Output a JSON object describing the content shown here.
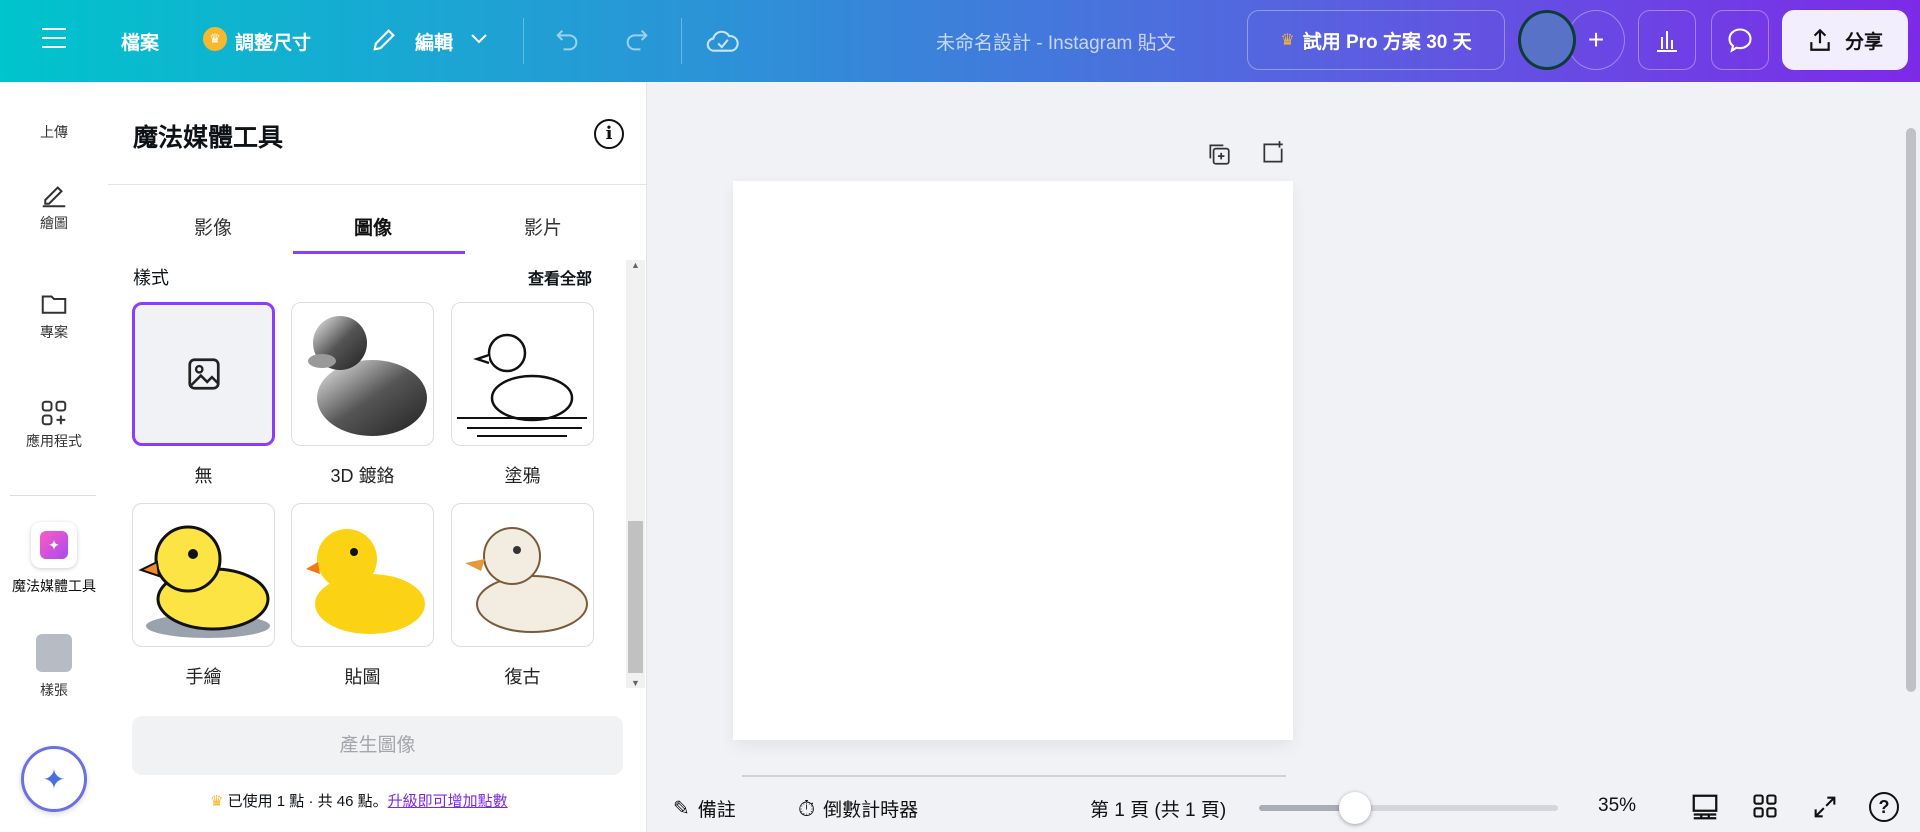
{
  "topbar": {
    "file": "檔案",
    "resize": "調整尺寸",
    "edit": "編輯",
    "title": "未命名設計 - Instagram 貼文",
    "pro": "試用 Pro 方案 30 天",
    "share": "分享"
  },
  "rail": {
    "upload": "上傳",
    "draw": "繪圖",
    "projects": "專案",
    "apps": "應用程式",
    "magic_media": "魔法媒體工具",
    "mockups": "樣張"
  },
  "panel": {
    "title": "魔法媒體工具",
    "tabs": [
      "影像",
      "圖像",
      "影片"
    ],
    "active_tab": "圖像",
    "styles_label": "樣式",
    "see_all": "查看全部",
    "styles": [
      "無",
      "3D 鍍鉻",
      "塗鴉",
      "手繪",
      "貼圖",
      "復古"
    ],
    "selected_style": "無",
    "generate": "產生圖像",
    "credits": "已使用 1 點 · 共 46 點。",
    "upgrade_link": "升級即可增加點數"
  },
  "bottombar": {
    "notes": "備註",
    "timer": "倒數計時器",
    "page": "第 1 頁 (共 1 頁)",
    "zoom": "35%",
    "zoom_value": 35
  },
  "colors": {
    "accent": "#8b3dff",
    "link": "#7d2ae8"
  }
}
